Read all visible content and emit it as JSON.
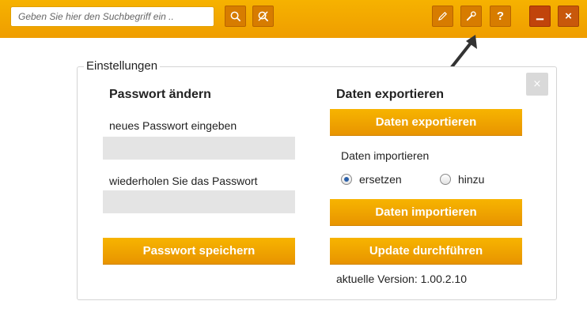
{
  "toolbar": {
    "search_placeholder": "Geben Sie hier den Suchbegriff ein ..",
    "buttons": {
      "search": "search-icon",
      "clear_search": "search-off-icon",
      "edit": "pencil-icon",
      "settings": "wrench-icon",
      "help": "?",
      "minimize": "minimize-icon",
      "close": "×"
    },
    "accent_color": "#f2a500"
  },
  "settings_panel": {
    "title": "Einstellungen",
    "close_label": "×",
    "password": {
      "heading": "Passwort ändern",
      "new_label": "neues Passwort eingeben",
      "new_value": "",
      "repeat_label": "wiederholen Sie das Passwort",
      "repeat_value": "",
      "save_button": "Passwort speichern"
    },
    "data": {
      "heading": "Daten exportieren",
      "export_button": "Daten exportieren",
      "import_label": "Daten importieren",
      "import_mode": {
        "options": [
          "ersetzen",
          "hinzu"
        ],
        "selected": "ersetzen"
      },
      "import_button": "Daten importieren",
      "update_button": "Update durchführen",
      "version_text": "aktuelle Version: 1.00.2.10"
    }
  }
}
